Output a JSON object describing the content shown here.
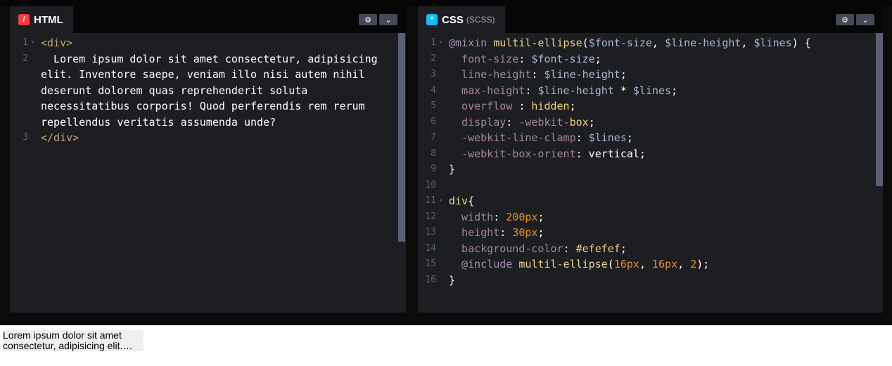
{
  "html_panel": {
    "title": "HTML",
    "logo_glyph": "/",
    "settings_icon": "gear-icon",
    "expand_icon": "chevron-down-icon",
    "lines": [
      {
        "n": "1",
        "fold": "▾",
        "tokens": [
          {
            "c": "tag",
            "t": "<div>"
          }
        ]
      },
      {
        "n": "2",
        "fold": "",
        "tokens": [
          {
            "c": "plain",
            "t": "  Lorem ipsum dolor sit amet consectetur, adipisicing"
          }
        ]
      },
      {
        "n": "",
        "fold": "",
        "tokens": [
          {
            "c": "plain",
            "t": "elit. Inventore saepe, veniam illo nisi autem nihil"
          }
        ]
      },
      {
        "n": "",
        "fold": "",
        "tokens": [
          {
            "c": "plain",
            "t": "deserunt dolorem quas reprehenderit soluta"
          }
        ]
      },
      {
        "n": "",
        "fold": "",
        "tokens": [
          {
            "c": "plain",
            "t": "necessitatibus corporis! Quod perferendis rem rerum"
          }
        ]
      },
      {
        "n": "",
        "fold": "",
        "tokens": [
          {
            "c": "plain",
            "t": "repellendus veritatis assumenda unde?"
          }
        ]
      },
      {
        "n": "3",
        "fold": "",
        "tokens": [
          {
            "c": "tag",
            "t": "</div>"
          }
        ]
      }
    ]
  },
  "css_panel": {
    "title": "CSS",
    "subtitle": "(SCSS)",
    "logo_glyph": "*",
    "settings_icon": "gear-icon",
    "expand_icon": "chevron-down-icon",
    "lines": [
      {
        "n": "1",
        "fold": "▾",
        "tokens": [
          {
            "c": "kw",
            "t": "@mixin "
          },
          {
            "c": "fn",
            "t": "multil-ellipse"
          },
          {
            "c": "plain",
            "t": "("
          },
          {
            "c": "var",
            "t": "$font-size"
          },
          {
            "c": "plain",
            "t": ", "
          },
          {
            "c": "var",
            "t": "$line-height"
          },
          {
            "c": "plain",
            "t": ", "
          },
          {
            "c": "var",
            "t": "$lines"
          },
          {
            "c": "plain",
            "t": ") {"
          }
        ]
      },
      {
        "n": "2",
        "fold": "",
        "tokens": [
          {
            "c": "prop",
            "t": "  font-size"
          },
          {
            "c": "plain",
            "t": ": "
          },
          {
            "c": "var",
            "t": "$font-size"
          },
          {
            "c": "plain",
            "t": ";"
          }
        ]
      },
      {
        "n": "3",
        "fold": "",
        "tokens": [
          {
            "c": "prop",
            "t": "  line-height"
          },
          {
            "c": "plain",
            "t": ": "
          },
          {
            "c": "var",
            "t": "$line-height"
          },
          {
            "c": "plain",
            "t": ";"
          }
        ]
      },
      {
        "n": "4",
        "fold": "",
        "tokens": [
          {
            "c": "prop",
            "t": "  max-height"
          },
          {
            "c": "plain",
            "t": ": "
          },
          {
            "c": "var",
            "t": "$line-height"
          },
          {
            "c": "plain",
            "t": " * "
          },
          {
            "c": "var",
            "t": "$lines"
          },
          {
            "c": "plain",
            "t": ";"
          }
        ]
      },
      {
        "n": "5",
        "fold": "",
        "tokens": [
          {
            "c": "prop",
            "t": "  overflow"
          },
          {
            "c": "plain",
            "t": " : "
          },
          {
            "c": "val",
            "t": "hidden"
          },
          {
            "c": "plain",
            "t": ";"
          }
        ]
      },
      {
        "n": "6",
        "fold": "",
        "tokens": [
          {
            "c": "prop",
            "t": "  display"
          },
          {
            "c": "plain",
            "t": ": "
          },
          {
            "c": "prop",
            "t": "-webkit-"
          },
          {
            "c": "val",
            "t": "box"
          },
          {
            "c": "plain",
            "t": ";"
          }
        ]
      },
      {
        "n": "7",
        "fold": "",
        "tokens": [
          {
            "c": "prop",
            "t": "  -webkit-line-clamp"
          },
          {
            "c": "plain",
            "t": ": "
          },
          {
            "c": "var",
            "t": "$lines"
          },
          {
            "c": "plain",
            "t": ";"
          }
        ]
      },
      {
        "n": "8",
        "fold": "",
        "tokens": [
          {
            "c": "prop",
            "t": "  -webkit-box-orient"
          },
          {
            "c": "plain",
            "t": ": vertical;"
          }
        ]
      },
      {
        "n": "9",
        "fold": "",
        "tokens": [
          {
            "c": "plain",
            "t": "}"
          }
        ]
      },
      {
        "n": "10",
        "fold": "",
        "tokens": []
      },
      {
        "n": "11",
        "fold": "▾",
        "tokens": [
          {
            "c": "fn",
            "t": "div"
          },
          {
            "c": "plain",
            "t": "{"
          }
        ]
      },
      {
        "n": "12",
        "fold": "",
        "tokens": [
          {
            "c": "prop",
            "t": "  width"
          },
          {
            "c": "plain",
            "t": ": "
          },
          {
            "c": "num",
            "t": "200px"
          },
          {
            "c": "plain",
            "t": ";"
          }
        ]
      },
      {
        "n": "13",
        "fold": "",
        "tokens": [
          {
            "c": "prop",
            "t": "  height"
          },
          {
            "c": "plain",
            "t": ": "
          },
          {
            "c": "num",
            "t": "30px"
          },
          {
            "c": "plain",
            "t": ";"
          }
        ]
      },
      {
        "n": "14",
        "fold": "",
        "tokens": [
          {
            "c": "prop",
            "t": "  background-color"
          },
          {
            "c": "plain",
            "t": ": "
          },
          {
            "c": "hex",
            "t": "#efefef"
          },
          {
            "c": "plain",
            "t": ";"
          }
        ]
      },
      {
        "n": "15",
        "fold": "",
        "tokens": [
          {
            "c": "kw",
            "t": "  @include "
          },
          {
            "c": "fn",
            "t": "multil-ellipse"
          },
          {
            "c": "plain",
            "t": "("
          },
          {
            "c": "num",
            "t": "16px"
          },
          {
            "c": "plain",
            "t": ", "
          },
          {
            "c": "num",
            "t": "16px"
          },
          {
            "c": "plain",
            "t": ", "
          },
          {
            "c": "num",
            "t": "2"
          },
          {
            "c": "plain",
            "t": ");"
          }
        ]
      },
      {
        "n": "16",
        "fold": "",
        "tokens": [
          {
            "c": "plain",
            "t": "}"
          }
        ]
      }
    ]
  },
  "preview": {
    "text": "Lorem ipsum dolor sit amet consectetur, adipisicing elit.…"
  },
  "colors": {
    "panel_bg": "#1d1e22",
    "html_logo": "#ff3c41",
    "css_logo": "#0ebeff",
    "preview_bg": "#efefef"
  }
}
